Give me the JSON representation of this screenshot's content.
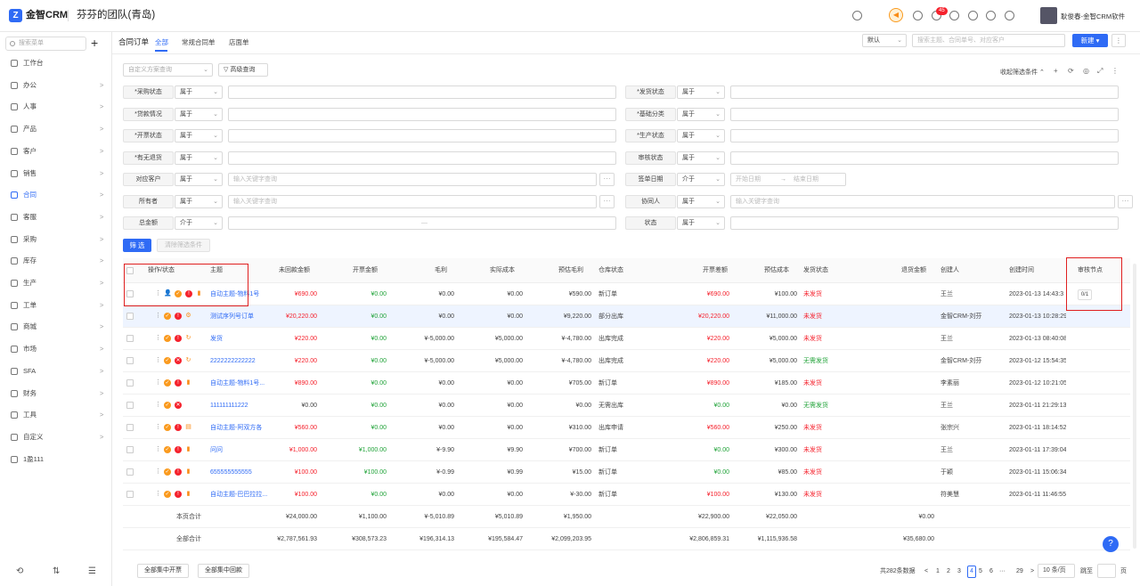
{
  "header": {
    "logo_letter": "Z",
    "brand": "金智CRM",
    "team": "芬芬的团队(青岛)",
    "user": "耿俊春-金智CRM软件",
    "notify_count": "45",
    "icons": [
      "search-icon",
      "sound-icon",
      "contacts-icon",
      "bell-icon",
      "gear-icon",
      "chart-icon",
      "cube-icon",
      "check-circle-icon"
    ]
  },
  "sidebar": {
    "search_placeholder": "搜索菜单",
    "plus": "+",
    "items": [
      {
        "label": "工作台",
        "arrow": ""
      },
      {
        "label": "办公",
        "arrow": ">"
      },
      {
        "label": "人事",
        "arrow": ">"
      },
      {
        "label": "产品",
        "arrow": ">"
      },
      {
        "label": "客户",
        "arrow": ">"
      },
      {
        "label": "销售",
        "arrow": ">"
      },
      {
        "label": "合同",
        "arrow": ">"
      },
      {
        "label": "客服",
        "arrow": ">"
      },
      {
        "label": "采购",
        "arrow": ">"
      },
      {
        "label": "库存",
        "arrow": ">"
      },
      {
        "label": "生产",
        "arrow": ">"
      },
      {
        "label": "工单",
        "arrow": ">"
      },
      {
        "label": "商城",
        "arrow": ">"
      },
      {
        "label": "市场",
        "arrow": ">"
      },
      {
        "label": "SFA",
        "arrow": ">"
      },
      {
        "label": "财务",
        "arrow": ">"
      },
      {
        "label": "工具",
        "arrow": ">"
      },
      {
        "label": "自定义",
        "arrow": ">"
      },
      {
        "label": "1盈111",
        "arrow": ""
      }
    ],
    "active_index": 6,
    "bottom": [
      "⟲",
      "⇅",
      "☰"
    ]
  },
  "page": {
    "title": "合同订单",
    "tabs": [
      "全部",
      "常规合同单",
      "店面单"
    ],
    "view_select": "默认",
    "search_placeholder": "搜索主题、合同单号、对应客户",
    "new_button": "新建 ▾",
    "more": "⋮"
  },
  "filter": {
    "scheme_placeholder": "自定义方案查询",
    "advanced": "高级查询",
    "collapse": "收起筛选条件 ⌃",
    "toolbar_icons": [
      "+",
      "⟳",
      "◎",
      "⤢",
      "⋮"
    ],
    "left": [
      {
        "label": "*采购状态",
        "op": "属于"
      },
      {
        "label": "*贷款情况",
        "op": "属于"
      },
      {
        "label": "*开票状态",
        "op": "属于"
      },
      {
        "label": "*有无退货",
        "op": "属于"
      },
      {
        "label": "对应客户",
        "op": "属于",
        "placeholder": "输入关键字查询"
      },
      {
        "label": "所有者",
        "op": "属于",
        "placeholder": "输入关键字查询"
      },
      {
        "label": "总金额",
        "op": "介于",
        "range_sep": "—"
      }
    ],
    "right": [
      {
        "label": "*发货状态",
        "op": "属于"
      },
      {
        "label": "*基础分类",
        "op": "属于"
      },
      {
        "label": "*生产状态",
        "op": "属于"
      },
      {
        "label": "审核状态",
        "op": "属于"
      },
      {
        "label": "签单日期",
        "op": "介于",
        "start": "开始日期",
        "end": "结束日期",
        "arrow": "→"
      },
      {
        "label": "协同人",
        "op": "属于",
        "placeholder": "输入关键字查询"
      },
      {
        "label": "状态",
        "op": "属于"
      }
    ],
    "filter_btn": "筛 选",
    "clear_btn": "清除筛选条件",
    "dots": "···"
  },
  "table": {
    "headers": [
      "操作/状态",
      "主题",
      "未回款金额",
      "开票金额",
      "毛利",
      "实际成本",
      "预估毛利",
      "仓库状态",
      "开票差额",
      "预估成本",
      "发货状态",
      "退货金额",
      "创建人",
      "创建时间",
      "审核节点"
    ],
    "rows": [
      {
        "subject": "自动主题-物料1号",
        "unpaid": "¥690.00",
        "uc": "red",
        "invoice": "¥0.00",
        "profit": "¥0.00",
        "cost": "¥0.00",
        "eprofit": "¥590.00",
        "stock": "新订单",
        "diff": "¥690.00",
        "dc": "red",
        "ecost": "¥100.00",
        "ship": "未发货",
        "sc": "red",
        "ret": "",
        "creator": "王兰",
        "time": "2023-01-13 14:43:3",
        "audit": "0/1",
        "ops": [
          "⋮",
          "👤",
          "✓",
          "!",
          "▮"
        ]
      },
      {
        "subject": "测试序列号订单",
        "unpaid": "¥20,220.00",
        "uc": "red",
        "invoice": "¥0.00",
        "profit": "¥0.00",
        "cost": "¥0.00",
        "eprofit": "¥9,220.00",
        "stock": "部分出库",
        "diff": "¥20,220.00",
        "dc": "red",
        "ecost": "¥11,000.00",
        "ship": "未发货",
        "sc": "red",
        "ret": "",
        "creator": "金智CRM-刘芬",
        "time": "2023-01-13 10:28:29",
        "audit": "",
        "ops": [
          "⋮",
          "✓",
          "!",
          "⚙"
        ]
      },
      {
        "subject": "发货",
        "unpaid": "¥220.00",
        "uc": "red",
        "invoice": "¥0.00",
        "profit": "¥-5,000.00",
        "cost": "¥5,000.00",
        "eprofit": "¥-4,780.00",
        "stock": "出库完成",
        "diff": "¥220.00",
        "dc": "red",
        "ecost": "¥5,000.00",
        "ship": "未发货",
        "sc": "red",
        "ret": "",
        "creator": "王兰",
        "time": "2023-01-13 08:40:08",
        "audit": "",
        "ops": [
          "⋮",
          "✓",
          "!",
          "↻"
        ]
      },
      {
        "subject": "2222222222222",
        "unpaid": "¥220.00",
        "uc": "red",
        "invoice": "¥0.00",
        "profit": "¥-5,000.00",
        "cost": "¥5,000.00",
        "eprofit": "¥-4,780.00",
        "stock": "出库完成",
        "diff": "¥220.00",
        "dc": "red",
        "ecost": "¥5,000.00",
        "ship": "无需发货",
        "sc": "green",
        "ret": "",
        "creator": "金智CRM-刘芬",
        "time": "2023-01-12 15:54:35",
        "audit": "",
        "ops": [
          "⋮",
          "✓",
          "✕",
          "↻"
        ]
      },
      {
        "subject": "自动主题-物料1号...",
        "unpaid": "¥890.00",
        "uc": "red",
        "invoice": "¥0.00",
        "profit": "¥0.00",
        "cost": "¥0.00",
        "eprofit": "¥705.00",
        "stock": "新订单",
        "diff": "¥890.00",
        "dc": "red",
        "ecost": "¥185.00",
        "ship": "未发货",
        "sc": "red",
        "ret": "",
        "creator": "李素丽",
        "time": "2023-01-12 10:21:05",
        "audit": "",
        "ops": [
          "⋮",
          "✓",
          "!",
          "▮"
        ]
      },
      {
        "subject": "111111111222",
        "unpaid": "¥0.00",
        "uc": "gray",
        "invoice": "¥0.00",
        "profit": "¥0.00",
        "cost": "¥0.00",
        "eprofit": "¥0.00",
        "stock": "无需出库",
        "diff": "¥0.00",
        "dc": "green",
        "ecost": "¥0.00",
        "ship": "无需发货",
        "sc": "green",
        "ret": "",
        "creator": "王兰",
        "time": "2023-01-11 21:29:13",
        "audit": "",
        "ops": [
          "⋮",
          "✓",
          "✕"
        ]
      },
      {
        "subject": "自动主题-阿双方各",
        "unpaid": "¥560.00",
        "uc": "red",
        "invoice": "¥0.00",
        "profit": "¥0.00",
        "cost": "¥0.00",
        "eprofit": "¥310.00",
        "stock": "出库申请",
        "diff": "¥560.00",
        "dc": "red",
        "ecost": "¥250.00",
        "ship": "未发货",
        "sc": "red",
        "ret": "",
        "creator": "张宗兴",
        "time": "2023-01-11 18:14:52",
        "audit": "",
        "ops": [
          "⋮",
          "✓",
          "!",
          "▤"
        ]
      },
      {
        "subject": "问问",
        "unpaid": "¥1,000.00",
        "uc": "red",
        "invoice": "¥1,000.00",
        "profit": "¥-9.90",
        "cost": "¥9.90",
        "eprofit": "¥700.00",
        "stock": "新订单",
        "diff": "¥0.00",
        "dc": "green",
        "ecost": "¥300.00",
        "ship": "未发货",
        "sc": "red",
        "ret": "",
        "creator": "王兰",
        "time": "2023-01-11 17:39:04",
        "audit": "",
        "ops": [
          "⋮",
          "✓",
          "!",
          "▮"
        ]
      },
      {
        "subject": "655555555555",
        "unpaid": "¥100.00",
        "uc": "red",
        "invoice": "¥100.00",
        "profit": "¥-0.99",
        "cost": "¥0.99",
        "eprofit": "¥15.00",
        "stock": "新订单",
        "diff": "¥0.00",
        "dc": "green",
        "ecost": "¥85.00",
        "ship": "未发货",
        "sc": "red",
        "ret": "",
        "creator": "于颖",
        "time": "2023-01-11 15:06:34",
        "audit": "",
        "ops": [
          "⋮",
          "✓",
          "!",
          "▮"
        ]
      },
      {
        "subject": "自动主题-巴巴拉拉...",
        "unpaid": "¥100.00",
        "uc": "red",
        "invoice": "¥0.00",
        "profit": "¥0.00",
        "cost": "¥0.00",
        "eprofit": "¥-30.00",
        "stock": "新订单",
        "diff": "¥100.00",
        "dc": "red",
        "ecost": "¥130.00",
        "ship": "未发货",
        "sc": "red",
        "ret": "",
        "creator": "符美慧",
        "time": "2023-01-11 11:46:55",
        "audit": "",
        "ops": [
          "⋮",
          "✓",
          "!",
          "▮"
        ]
      }
    ],
    "page_total": {
      "label": "本页合计",
      "unpaid": "¥24,000.00",
      "invoice": "¥1,100.00",
      "profit": "¥-5,010.89",
      "cost": "¥5,010.89",
      "eprofit": "¥1,950.00",
      "diff": "¥22,900.00",
      "ecost": "¥22,050.00",
      "ret": "¥0.00"
    },
    "all_total": {
      "label": "全部合计",
      "unpaid": "¥2,787,561.93",
      "invoice": "¥308,573.23",
      "profit": "¥196,314.13",
      "cost": "¥195,584.47",
      "eprofit": "¥2,099,203.95",
      "diff": "¥2,806,859.31",
      "ecost": "¥1,115,936.58",
      "ret": "¥35,680.00"
    }
  },
  "footer": {
    "btn_invoice": "全部集中开票",
    "btn_collect": "全部集中回款",
    "total": "共282条数据",
    "pages": [
      "<",
      "1",
      "2",
      "3",
      "4",
      "5",
      "6",
      "···",
      "29",
      ">"
    ],
    "current": "4",
    "per_page": "10 条/页",
    "goto": "跳至",
    "page_unit": "页",
    "help": "?"
  }
}
